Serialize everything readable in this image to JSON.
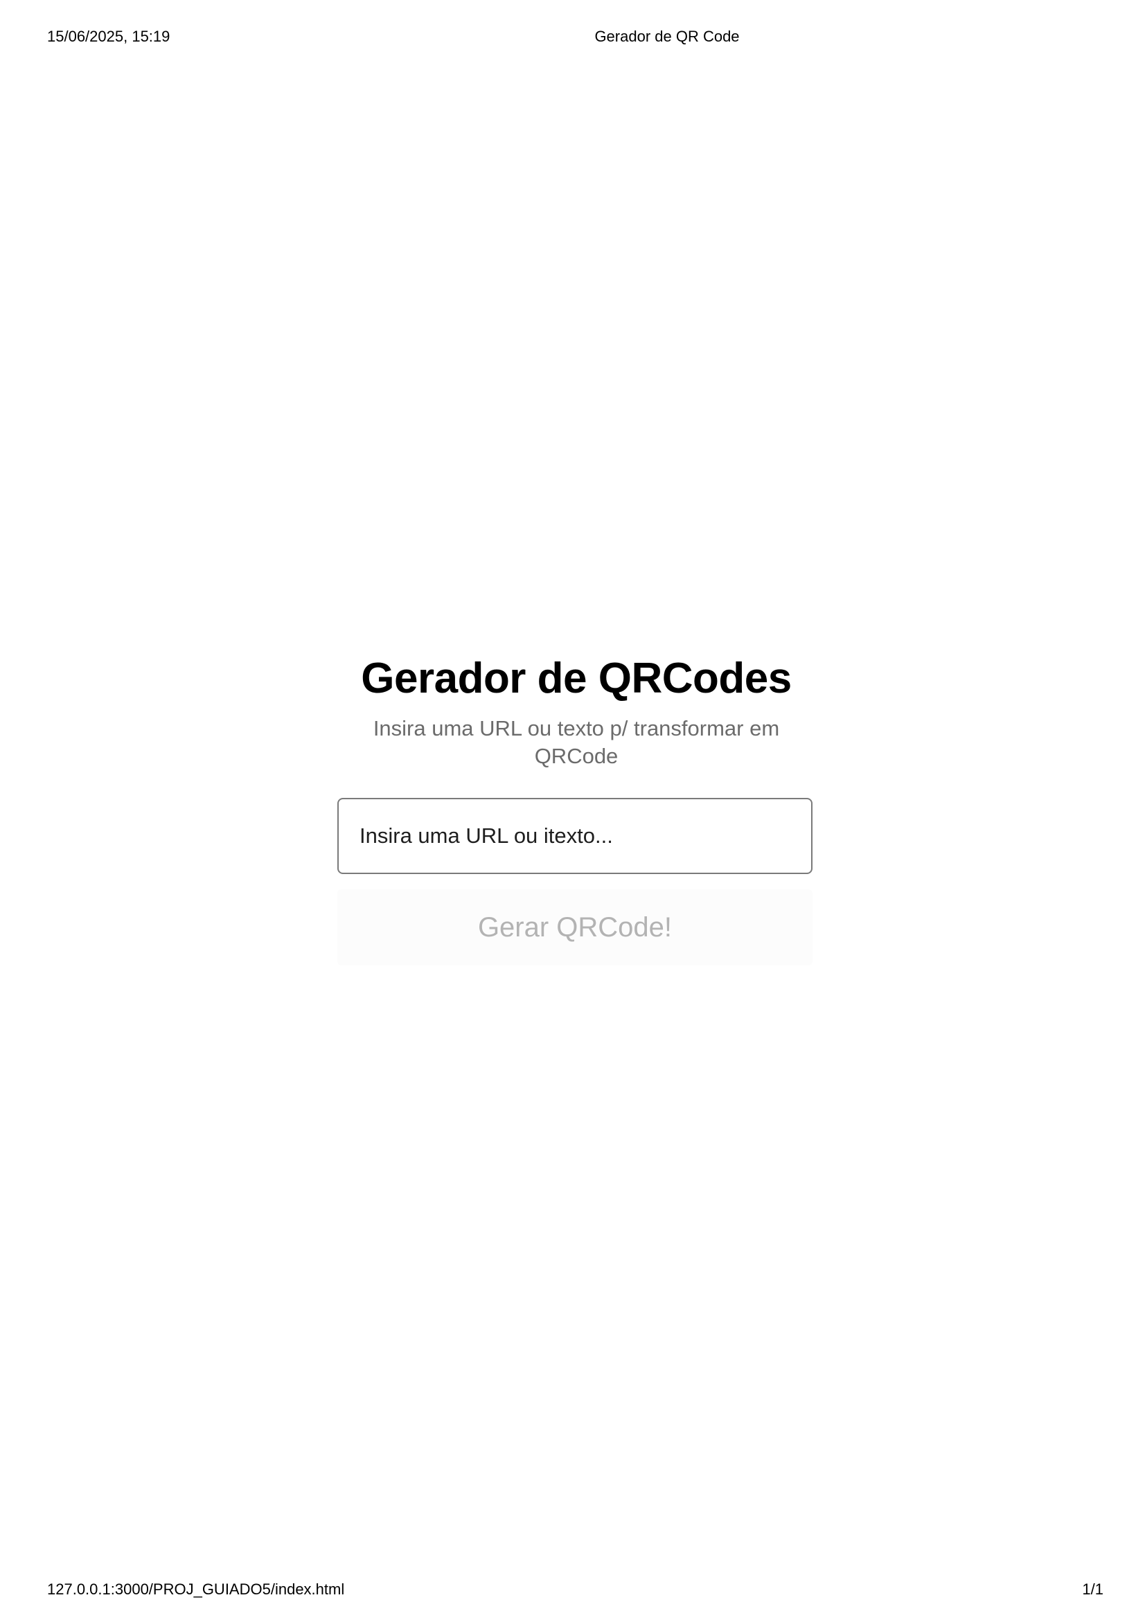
{
  "print_header": {
    "datetime": "15/06/2025, 15:19",
    "doc_title": "Gerador de QR Code"
  },
  "print_footer": {
    "url": "127.0.0.1:3000/PROJ_GUIADO5/index.html",
    "page": "1/1"
  },
  "main": {
    "title": "Gerador de QRCodes",
    "subtitle": "Insira uma URL ou texto p/ transformar em QRCode",
    "input": {
      "placeholder": "Insira uma URL ou itexto...",
      "value": ""
    },
    "button_label": "Gerar QRCode!"
  },
  "colors": {
    "background": "#ffffff",
    "title": "#000000",
    "subtitle": "#6b6b6b",
    "input_border": "#7a7a7a",
    "button_text_disabled": "#b3b3b3",
    "button_bg": "#fcfcfc"
  }
}
